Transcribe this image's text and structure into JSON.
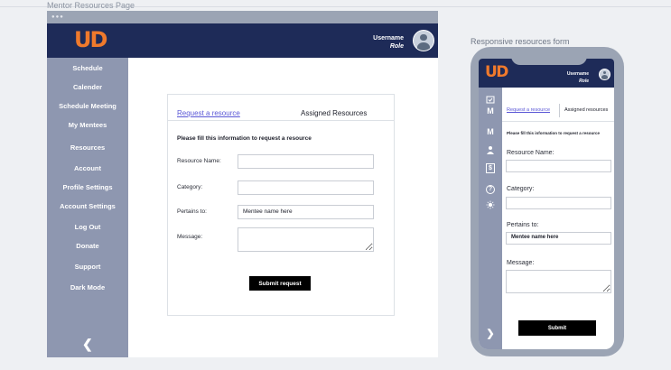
{
  "desktop": {
    "frame_label": "Mentor Resources Page",
    "user": {
      "username": "Username",
      "role": "Role"
    },
    "sidebar": {
      "items": [
        {
          "label": "Schedule"
        },
        {
          "label": "Calender"
        },
        {
          "label": "Schedule Meeting"
        },
        {
          "label": "My Mentees"
        },
        {
          "label": "Resources"
        },
        {
          "label": "Account"
        },
        {
          "label": "Profile Settings"
        },
        {
          "label": "Account Settings"
        },
        {
          "label": "Log Out"
        },
        {
          "label": "Donate"
        },
        {
          "label": "Support"
        },
        {
          "label": "Dark Mode"
        }
      ],
      "collapse_icon": "chevron-left-icon"
    },
    "tabs": [
      {
        "label": "Request a resource",
        "active": true
      },
      {
        "label": "Assigned Resources",
        "active": false
      }
    ],
    "form": {
      "hint": "Please fill this information to request a resource",
      "fields": {
        "resource_name": {
          "label": "Resource Name:",
          "value": ""
        },
        "category": {
          "label": "Category:",
          "value": ""
        },
        "pertains_to": {
          "label": "Pertains to:",
          "value": "Mentee name here"
        },
        "message": {
          "label": "Message:",
          "value": ""
        }
      },
      "submit_label": "Submit request"
    }
  },
  "mobile": {
    "frame_label": "Responsive resources form",
    "user": {
      "username": "Username",
      "role": "Role"
    },
    "sidebar_icons": [
      "calendar-icon",
      "mentor-icon",
      "mentee-icon",
      "user-icon",
      "dollar-icon",
      "help-icon",
      "sun-icon"
    ],
    "sidebar_glyphs": {
      "m1": "M",
      "m2": "M",
      "dollar": "$",
      "help": "?"
    },
    "tabs": [
      {
        "label": "Request a resource",
        "active": true
      },
      {
        "label": "Assigned resources",
        "active": false
      }
    ],
    "form": {
      "hint": "Please fill this information to request a resource",
      "fields": {
        "resource_name": {
          "label": "Resource Name:",
          "value": ""
        },
        "category": {
          "label": "Category:",
          "value": ""
        },
        "pertains_to": {
          "label": "Pertains to:",
          "value": "Mentee name here"
        },
        "message": {
          "label": "Message:",
          "value": ""
        }
      },
      "submit_label": "Submit"
    }
  },
  "colors": {
    "header": "#1e2b58",
    "sidebar": "#8e97b0",
    "brand": "#f07a2c",
    "active_tab": "#5a57d6",
    "button": "#000000"
  }
}
